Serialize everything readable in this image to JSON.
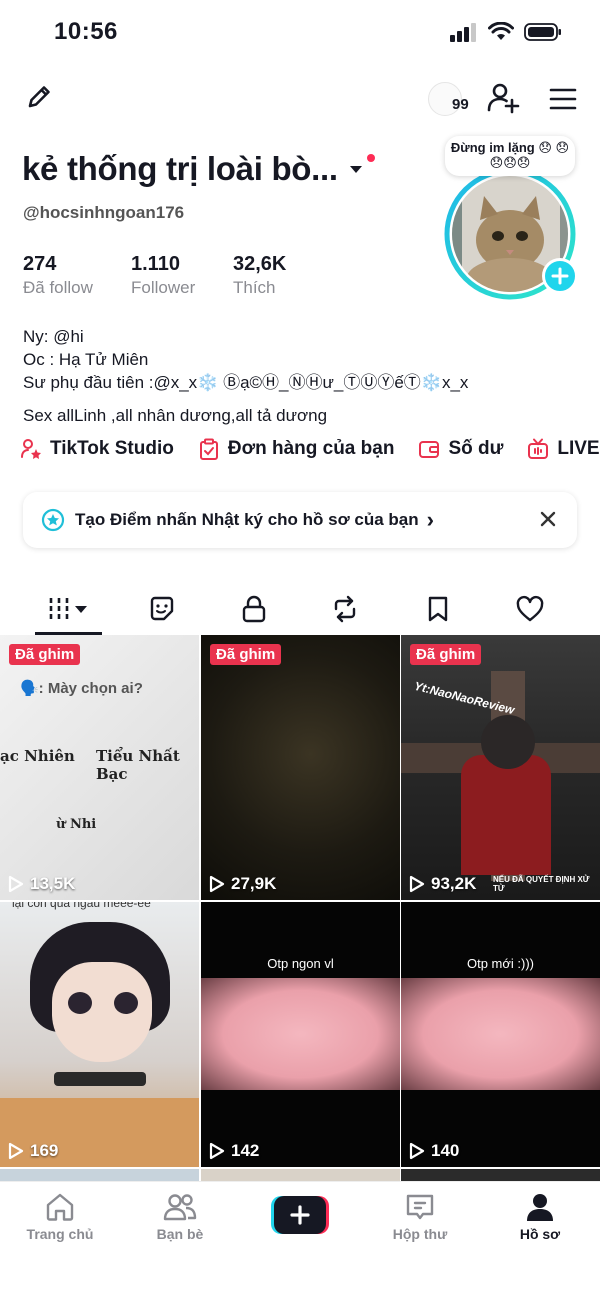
{
  "status_bar": {
    "time": "10:56"
  },
  "header": {
    "notification_count": "99"
  },
  "profile": {
    "display_name": "kẻ thống trị loài bò...",
    "handle": "@hocsinhngoan176",
    "status_bubble": "Đừng im lặng 😞 😞😞😞😞",
    "stats": [
      {
        "value": "274",
        "label": "Đã follow"
      },
      {
        "value": "1.110",
        "label": "Follower"
      },
      {
        "value": "32,6K",
        "label": "Thích"
      }
    ],
    "bio_lines": [
      "Ny: @hi",
      "Oc : Hạ Tử Miên",
      "Sư phụ đầu tiên :@x_x❄️ Ⓑạ©Ⓗ_ⓃⒽư_ⓉⓊⓎếⓉ❄️x_x",
      "Sex allLinh ,all nhân dương,all tả dương"
    ]
  },
  "quick_links": [
    {
      "label": "TikTok Studio",
      "icon": "studio-icon"
    },
    {
      "label": "Đơn hàng của bạn",
      "icon": "order-icon"
    },
    {
      "label": "Số dư",
      "icon": "wallet-icon"
    },
    {
      "label": "LIVE",
      "icon": "live-icon"
    }
  ],
  "promo": {
    "text": "Tạo Điểm nhấn Nhật ký cho hồ sơ của bạn",
    "chevron": "›"
  },
  "tabs": [
    {
      "icon": "grid-icon"
    },
    {
      "icon": "sticker-icon"
    },
    {
      "icon": "lock-icon"
    },
    {
      "icon": "repost-icon"
    },
    {
      "icon": "bookmark-icon"
    },
    {
      "icon": "heart-icon"
    }
  ],
  "videos": [
    {
      "pinned": "Đã ghim",
      "views": "13,5K",
      "caption": "🗣️: Mày chọn ai?",
      "names": [
        "ạc Nhiên",
        "Tiểu Nhất Bạc",
        "ừ Nhi"
      ]
    },
    {
      "pinned": "Đã ghim",
      "views": "27,9K"
    },
    {
      "pinned": "Đã ghim",
      "views": "93,2K",
      "caption": "Yt:NaoNaoReview",
      "footer": "NẾU ĐÃ QUYẾT ĐỊNH XỬ TỬ"
    },
    {
      "views": "169",
      "caption": "lại còn quá ngầu meee-ee"
    },
    {
      "views": "142",
      "caption": "Otp ngon vl"
    },
    {
      "views": "140",
      "caption": "Otp mới :)))"
    }
  ],
  "bottom_nav": [
    {
      "label": "Trang chủ",
      "icon": "home-icon"
    },
    {
      "label": "Bạn bè",
      "icon": "friends-icon"
    },
    {
      "label": "",
      "icon": "create-icon"
    },
    {
      "label": "Hộp thư",
      "icon": "inbox-icon"
    },
    {
      "label": "Hồ sơ",
      "icon": "profile-icon"
    }
  ],
  "colors": {
    "accent_red": "#fe2c55",
    "pin_red": "#e9334e",
    "ring_cyan": "#20d5ec"
  }
}
